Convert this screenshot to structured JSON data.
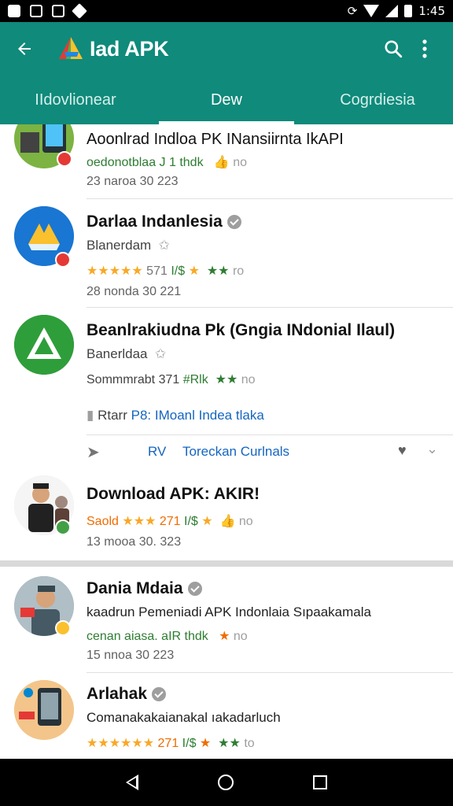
{
  "status_bar": {
    "time": "1:45",
    "left_icons": [
      "photo-icon",
      "image-icon",
      "gallery-icon",
      "diamond-icon"
    ],
    "right_icons": [
      "sync-icon",
      "wifi-icon",
      "signal-icon",
      "battery-icon"
    ]
  },
  "app_bar": {
    "title": "Iad APK",
    "accent": "#0f8a7b",
    "icons": [
      "back-arrow-icon",
      "app-logo-icon",
      "search-icon",
      "more-vert-icon"
    ]
  },
  "tabs": [
    {
      "label": "IIdovlionear",
      "active": false
    },
    {
      "label": "Dew",
      "active": true
    },
    {
      "label": "Cogrdiesia",
      "active": false
    }
  ],
  "items": [
    {
      "title": "Aoonlrad Indloa PK INansiirnta IkAPI",
      "sub_green": "oedonotblaa J 1 thdk",
      "sub_gray": "no",
      "date": "23 naroa 30 223"
    },
    {
      "title": "Darlaa Indanlesia",
      "sub": "Blanerdam",
      "rating_stars": "★★★★★",
      "rating_text": "571",
      "green_tag": "I/$",
      "meta_gray": "ro",
      "date": "28 nonda 30 221"
    },
    {
      "title": "Beanlrakiudna Pk (Gngia INdonial Ilaul)",
      "sub": "Banerldaa",
      "meta_text": "Sommmrabt 371",
      "green_tag": "#Rlk",
      "meta_gray": "no",
      "extra_label": "Rtarr",
      "extra_link": "P8: IMoanl Indea tlaka",
      "action_left": "RV",
      "action_mid": "Toreckan Curlnals"
    },
    {
      "title": "Download APK: AKIR!",
      "meta_orange": "Saold",
      "rating_stars": "★★★",
      "rating_text": "271",
      "green_tag": "I/$",
      "meta_gray": "no",
      "date": "13 mooa 30. 323"
    },
    {
      "title": "Dania Mdaia",
      "sub": "kaadrun Pemeniadi APK Indonlaia Sıpaakamala",
      "sub_green": "cenan aiasa. aIR thdk",
      "meta_gray": "no",
      "date": "15 nnoa 30 223"
    },
    {
      "title": "Arlahak",
      "sub": "Comanakakaianakal ıakadarluch",
      "rating_stars": "★★★★★★",
      "rating_text": "271",
      "green_tag": "I/$",
      "meta_gray": "to"
    }
  ],
  "colors": {
    "green": "#2e7d32",
    "gold": "#f9a825",
    "orange": "#ef6c00",
    "link_blue": "#1565c0"
  }
}
